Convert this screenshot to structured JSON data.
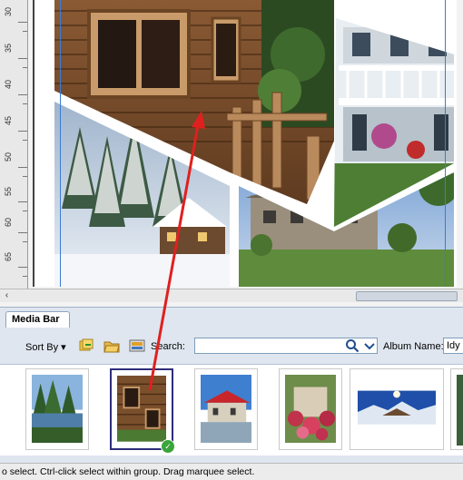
{
  "canvas": {
    "ruler_labels": [
      "30",
      "35",
      "40",
      "45",
      "50",
      "55",
      "60",
      "65"
    ],
    "collage": [
      {
        "name": "log-cabin-window-photo"
      },
      {
        "name": "white-porch-house-photo"
      },
      {
        "name": "snowy-cabin-photo"
      },
      {
        "name": "stone-house-photo"
      }
    ]
  },
  "media_bar": {
    "tab_label": "Media Bar",
    "sort_label": "Sort By",
    "sort_dropdown_glyph": "▾",
    "search_label": "Search:",
    "search_value": "",
    "album_label": "Album Name:",
    "album_value": "Idy",
    "icons": [
      "add-files-icon",
      "open-folder-icon",
      "import-icon",
      "search-icon",
      "chevron-down-icon"
    ],
    "thumbnails": [
      {
        "name": "thumb-lake-trees",
        "selected": false
      },
      {
        "name": "thumb-log-cabin",
        "selected": true,
        "badge": "✓"
      },
      {
        "name": "thumb-red-roof-house",
        "selected": false
      },
      {
        "name": "thumb-flower-cottage",
        "selected": false
      },
      {
        "name": "thumb-snow-panorama",
        "selected": false
      },
      {
        "name": "thumb-partial",
        "selected": false
      }
    ]
  },
  "status_bar": {
    "text": "o select. Ctrl-click select within group. Drag marquee select."
  },
  "colors": {
    "accent_arrow": "#e0201f",
    "guide_line": "#3a7bd5",
    "mediabar_bg": "#dfe6ef"
  }
}
